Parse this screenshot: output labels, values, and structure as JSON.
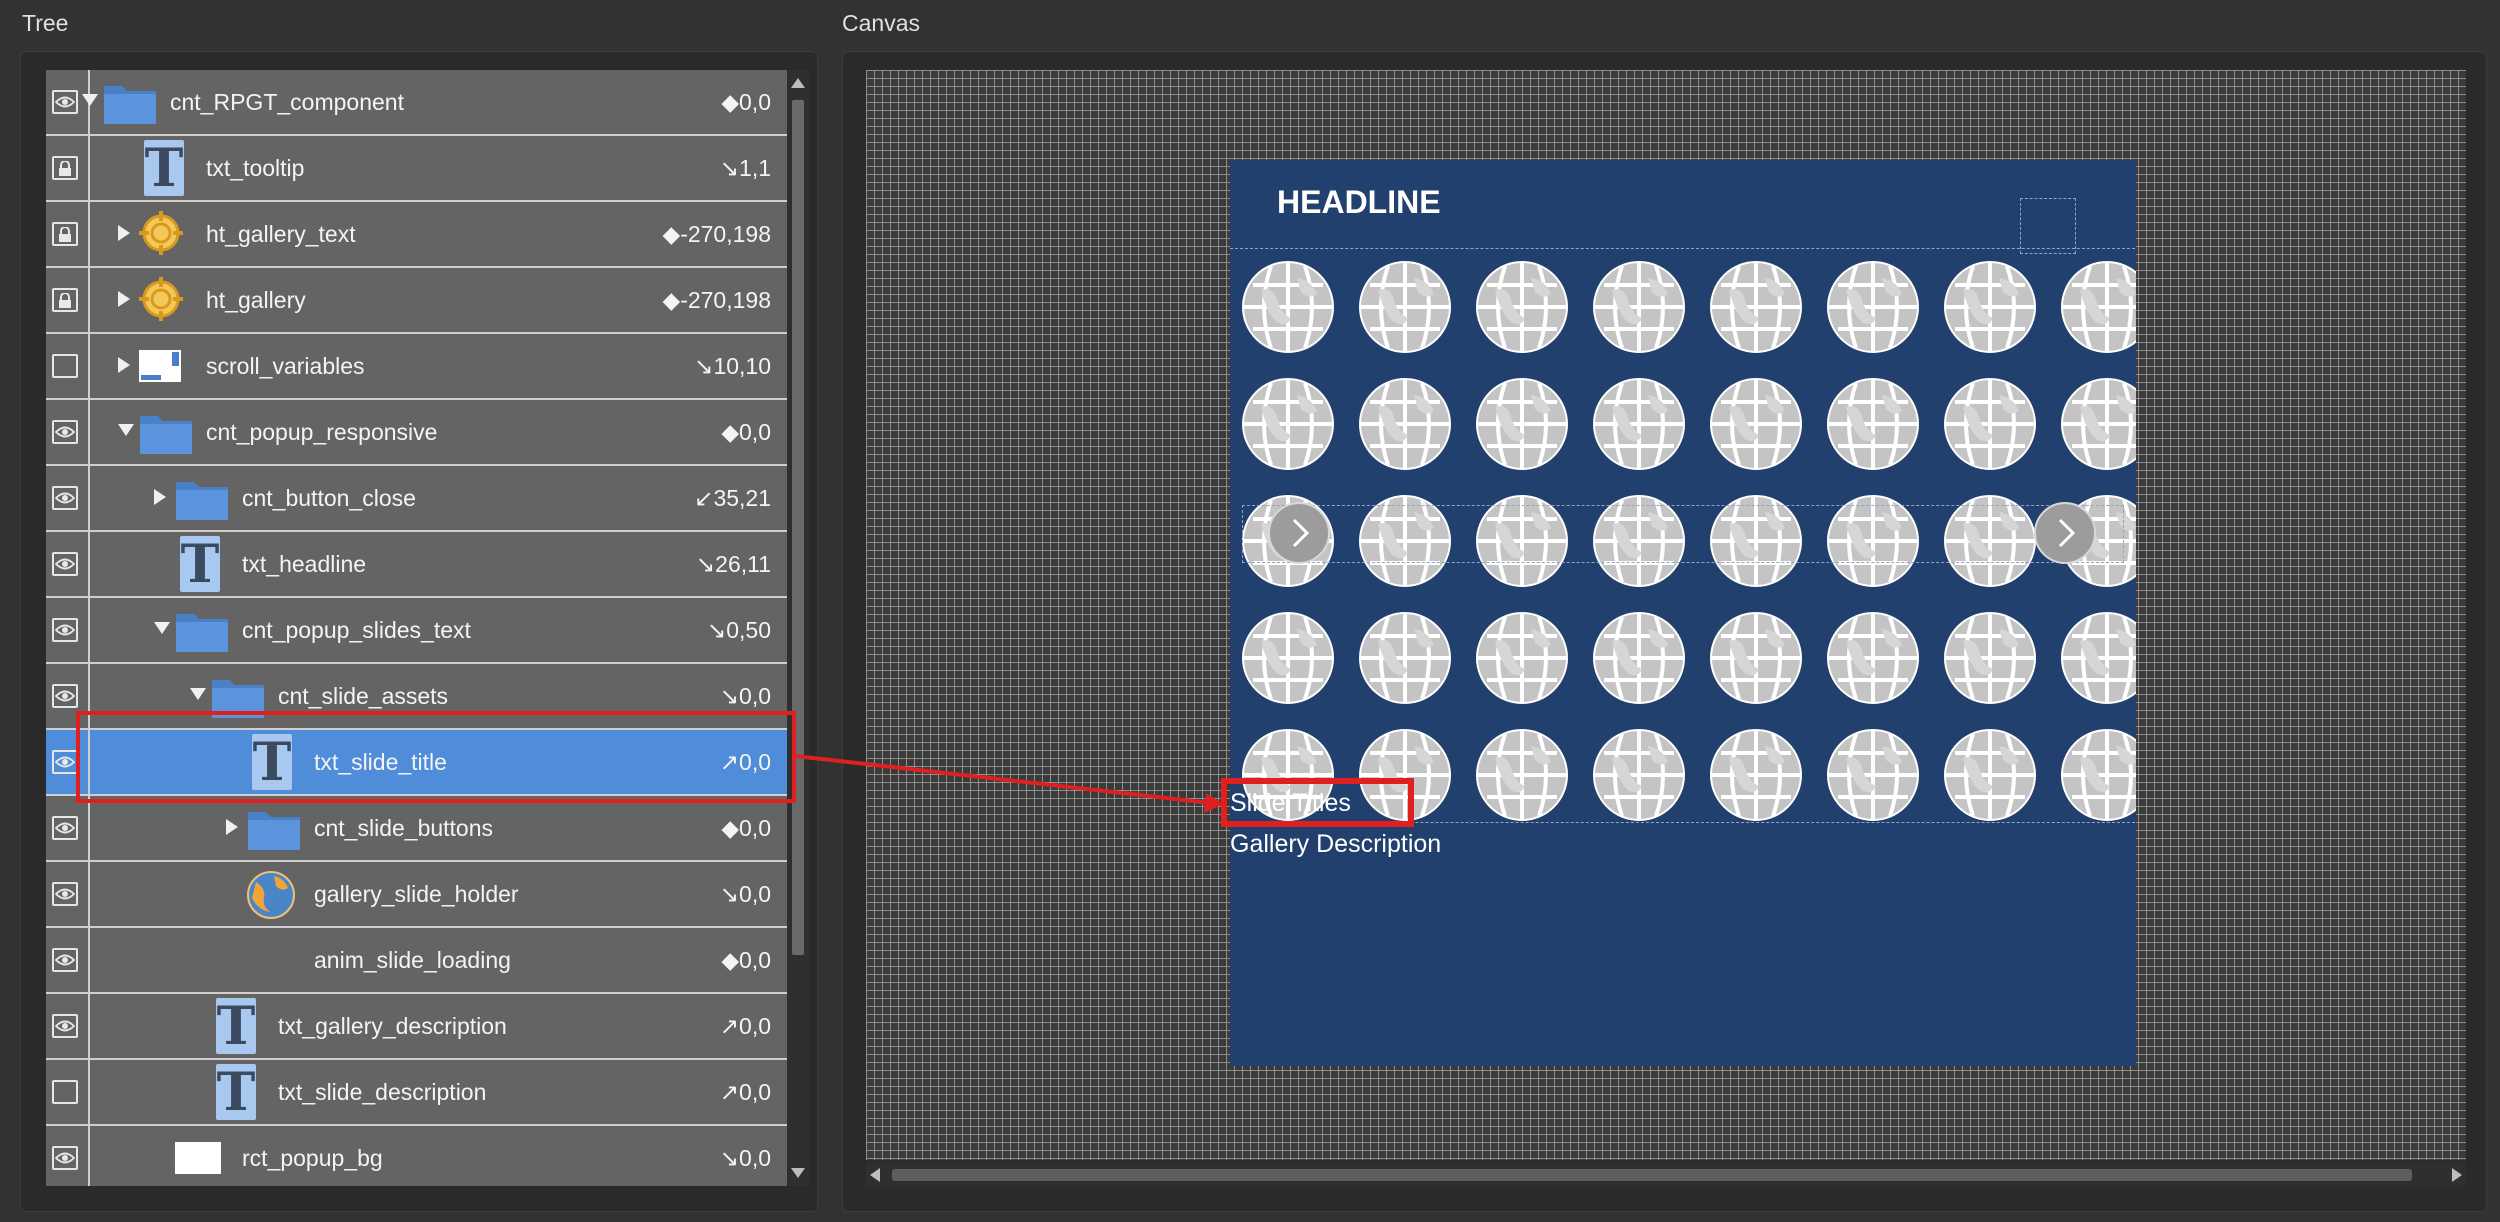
{
  "panels": {
    "tree_title": "Tree",
    "canvas_title": "Canvas"
  },
  "tree": {
    "rows": [
      {
        "label": "cnt_RPGT_component",
        "value": "◆0,0",
        "visibility": "eye",
        "icon": "folder-icon",
        "expand": "down"
      },
      {
        "label": "txt_tooltip",
        "value": "↘1,1",
        "visibility": "lock",
        "icon": "text-icon",
        "expand": "none"
      },
      {
        "label": "ht_gallery_text",
        "value": "◆-270,198",
        "visibility": "lock",
        "icon": "hotspot-icon",
        "expand": "right"
      },
      {
        "label": "ht_gallery",
        "value": "◆-270,198",
        "visibility": "lock",
        "icon": "hotspot-icon",
        "expand": "right"
      },
      {
        "label": "scroll_variables",
        "value": "↘10,10",
        "visibility": "empty",
        "icon": "scroll-area-icon",
        "expand": "right"
      },
      {
        "label": "cnt_popup_responsive",
        "value": "◆0,0",
        "visibility": "eye",
        "icon": "folder-icon",
        "expand": "down"
      },
      {
        "label": "cnt_button_close",
        "value": "↙35,21",
        "visibility": "eye",
        "icon": "folder-icon",
        "expand": "right"
      },
      {
        "label": "txt_headline",
        "value": "↘26,11",
        "visibility": "eye",
        "icon": "text-icon",
        "expand": "none"
      },
      {
        "label": "cnt_popup_slides_text",
        "value": "↘0,50",
        "visibility": "eye",
        "icon": "folder-icon",
        "expand": "down"
      },
      {
        "label": "cnt_slide_assets",
        "value": "↘0,0",
        "visibility": "eye",
        "icon": "folder-icon",
        "expand": "down"
      },
      {
        "label": "txt_slide_title",
        "value": "↗0,0",
        "visibility": "eye",
        "icon": "text-icon",
        "expand": "none",
        "selected": true
      },
      {
        "label": "cnt_slide_buttons",
        "value": "◆0,0",
        "visibility": "eye",
        "icon": "folder-icon",
        "expand": "right"
      },
      {
        "label": "gallery_slide_holder",
        "value": "↘0,0",
        "visibility": "eye",
        "icon": "globe-icon",
        "expand": "none"
      },
      {
        "label": "anim_slide_loading",
        "value": "◆0,0",
        "visibility": "eye",
        "icon": "none",
        "expand": "none"
      },
      {
        "label": "txt_gallery_description",
        "value": "↗0,0",
        "visibility": "eye",
        "icon": "text-icon",
        "expand": "none"
      },
      {
        "label": "txt_slide_description",
        "value": "↗0,0",
        "visibility": "empty",
        "icon": "text-icon",
        "expand": "none"
      },
      {
        "label": "rct_popup_bg",
        "value": "↘0,0",
        "visibility": "eye",
        "icon": "rectangle-icon",
        "expand": "none"
      }
    ]
  },
  "canvas": {
    "headline": "HEADLINE",
    "slide_title": "Slide Titles",
    "gallery_description": "Gallery Description",
    "popup_color": "#22406e",
    "highlight_color": "#e02020",
    "selection_color": "#4f8cd9"
  }
}
